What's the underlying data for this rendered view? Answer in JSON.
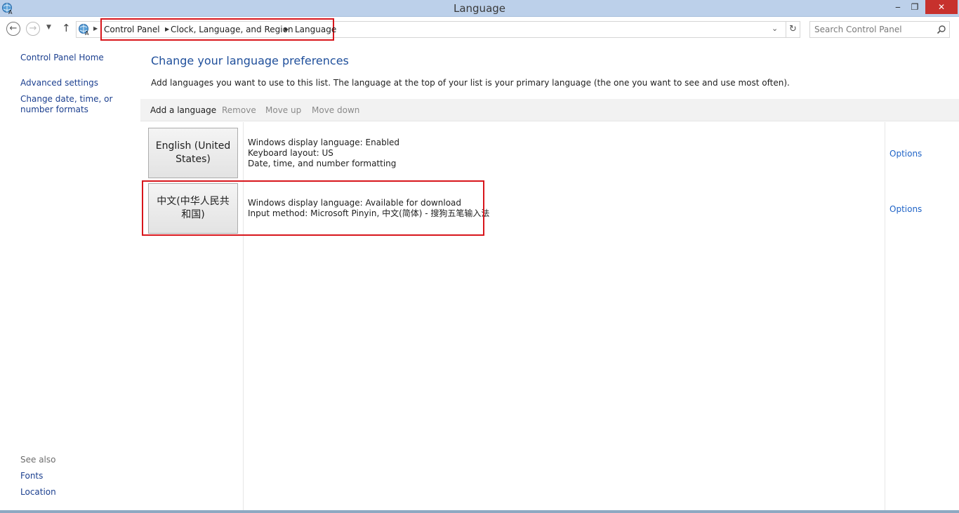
{
  "window": {
    "title": "Language",
    "minimize_glyph": "‒",
    "restore_glyph": "❐",
    "close_glyph": "✕"
  },
  "address_bar": {
    "breadcrumbs": [
      "Control Panel",
      "Clock, Language, and Region",
      "Language"
    ]
  },
  "search": {
    "placeholder": "Search Control Panel"
  },
  "sidebar": {
    "home": "Control Panel Home",
    "links": [
      "Advanced settings",
      "Change date, time, or number formats"
    ],
    "see_also_label": "See also",
    "see_also": [
      "Fonts",
      "Location"
    ]
  },
  "main": {
    "title": "Change your language preferences",
    "description": "Add languages you want to use to this list. The language at the top of your list is your primary language (the one you want to see and use most often).",
    "toolbar": {
      "add": "Add a language",
      "remove": "Remove",
      "move_up": "Move up",
      "move_down": "Move down"
    },
    "languages": [
      {
        "name": "English (United States)",
        "details": [
          "Windows display language: Enabled",
          "Keyboard layout: US",
          "Date, time, and number formatting"
        ],
        "options": "Options"
      },
      {
        "name": "中文(中华人民共和国)",
        "details": [
          "Windows display language: Available for download",
          "Input method: Microsoft Pinyin, 中文(简体) - 搜狗五笔输入法"
        ],
        "options": "Options"
      }
    ]
  },
  "colors": {
    "titlebar": "#bcd0ea",
    "link": "#1b3f8f",
    "heading": "#1f4f9b",
    "highlight": "#d8161c"
  }
}
